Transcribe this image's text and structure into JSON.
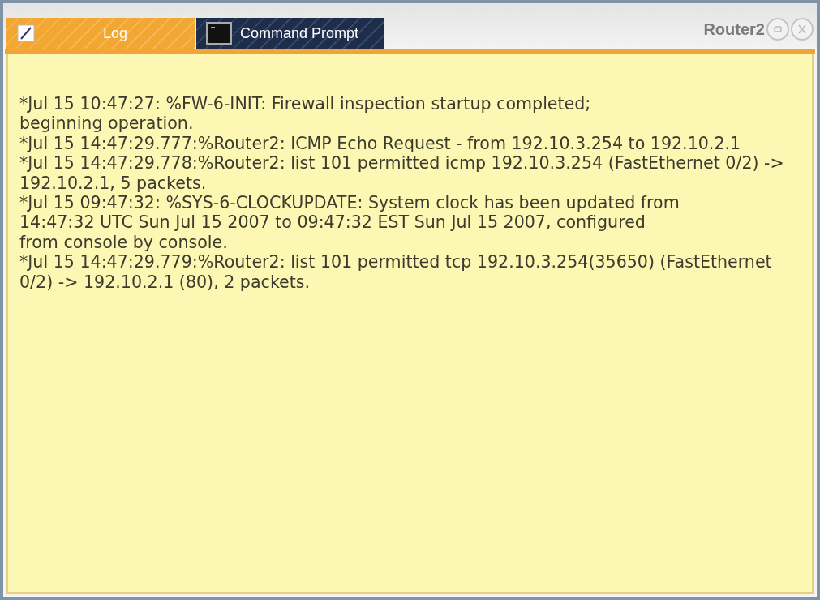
{
  "tabs": [
    {
      "label": "Log",
      "kind": "log",
      "selected": true
    },
    {
      "label": "Command Prompt",
      "kind": "terminal",
      "selected": false
    }
  ],
  "window": {
    "title": "Router2"
  },
  "log_lines": [
    "*Jul 15 10:47:27: %FW-6-INIT: Firewall inspection startup completed;",
    "beginning operation.",
    "*Jul 15 14:47:29.777:%Router2: ICMP Echo Request - from 192.10.3.254 to 192.10.2.1",
    "*Jul 15 14:47:29.778:%Router2: list 101 permitted icmp 192.10.3.254 (FastEthernet 0/2) ->",
    "192.10.2.1, 5 packets.",
    "*Jul 15 09:47:32: %SYS-6-CLOCKUPDATE: System clock has been updated from",
    "14:47:32 UTC Sun Jul 15 2007 to 09:47:32 EST Sun Jul 15 2007, configured",
    "from console by console.",
    "*Jul 15 14:47:29.779:%Router2: list 101 permitted tcp 192.10.3.254(35650) (FastEthernet",
    "0/2) -> 192.10.2.1 (80), 2 packets."
  ]
}
